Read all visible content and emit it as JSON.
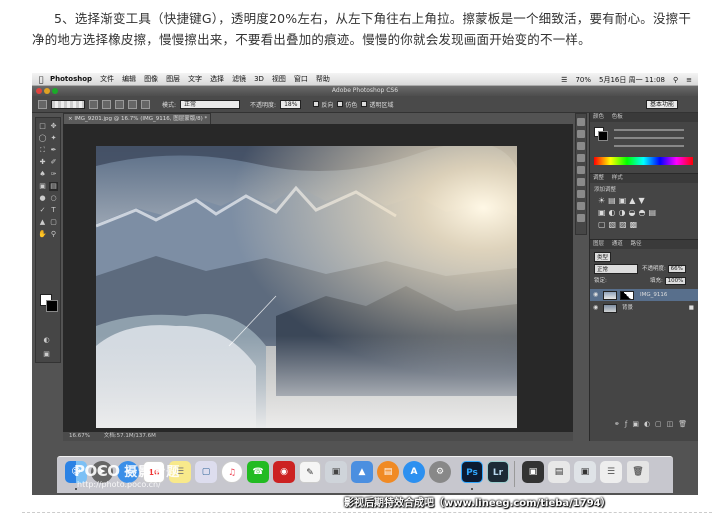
{
  "article": {
    "paragraph": "5、选择渐变工具（快捷键G），透明度20%左右，从左下角往右上角拉。擦蒙板是一个细致活，要有耐心。没擦干净的地方选择橡皮擦，慢慢擦出来，不要看出叠加的痕迹。慢慢的你就会发现画面开始变的不一样。"
  },
  "mac_menubar": {
    "apple_icon": "apple-icon",
    "app_name": "Photoshop",
    "menus": [
      "文件",
      "编辑",
      "图像",
      "图层",
      "文字",
      "选择",
      "滤镜",
      "3D",
      "视图",
      "窗口",
      "帮助"
    ],
    "status": {
      "battery": "70%",
      "date_time": "5月16日 周一 11:08"
    }
  },
  "ps_window": {
    "title": "Adobe Photoshop CS6",
    "options_bar": {
      "mode_label": "模式:",
      "mode_value": "正常",
      "opacity_label": "不透明度:",
      "opacity_value": "18%",
      "reverse_label": "反向",
      "dither_label": "仿色",
      "transparency_label": "透明区域",
      "workspace": "基本功能"
    },
    "document_tab": "IMG_9201.jpg @ 16.7% (IMG_9116, 图层蒙版/8) *",
    "status_bar": {
      "zoom": "16.67%",
      "doc_info": "文档:57.1M/137.6M"
    },
    "panels": {
      "color_tabs": [
        "颜色",
        "色板"
      ],
      "adjust_tabs": [
        "调整",
        "样式"
      ],
      "adjust_title": "添加调整",
      "layers_tabs": [
        "图层",
        "通道",
        "路径"
      ],
      "kind_label": "类型",
      "blend_mode": "正常",
      "opacity_label": "不透明度:",
      "opacity_value": "66%",
      "lock_label": "锁定:",
      "fill_label": "填充:",
      "fill_value": "100%",
      "layers": [
        {
          "name": "IMG_9116"
        },
        {
          "name": "背景"
        }
      ]
    }
  },
  "dock_apps": [
    "finder",
    "launchpad",
    "safari",
    "calendar",
    "notes",
    "preview",
    "itunes",
    "facetime",
    "photo-booth",
    "textedit",
    "image-capture",
    "keynote",
    "ibooks",
    "app-store",
    "system-preferences",
    "photoshop",
    "lightroom",
    "screenshots",
    "documents",
    "downloads",
    "trash"
  ],
  "dock_labels": {
    "calendar_date": "16",
    "photoshop": "Ps",
    "lightroom": "Lr"
  },
  "watermarks": {
    "poco_logo": "POCO",
    "poco_title": "摄影专题",
    "poco_url": "http://photo.poco.cn/",
    "tieba": "影视后期特效合成吧（www.lineeg.com/tieba/1794）"
  },
  "colors": {
    "ps_dark": "#535353",
    "ps_panel": "#454545",
    "tieba_text": "#ffffff"
  }
}
